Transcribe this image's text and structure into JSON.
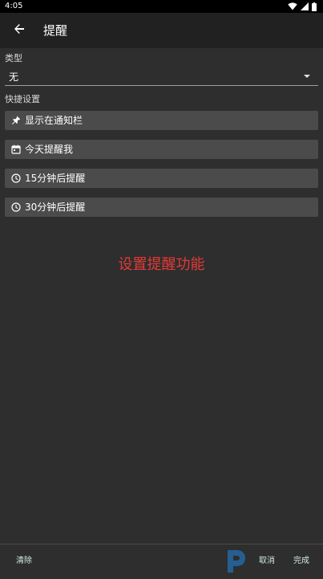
{
  "status_bar": {
    "time": "4:05",
    "icons": [
      "wifi-icon",
      "signal-icon",
      "battery-icon"
    ]
  },
  "app_bar": {
    "back_icon": "arrow-back-icon",
    "title": "提醒"
  },
  "type_section": {
    "label": "类型",
    "selected": "无"
  },
  "quick_section": {
    "label": "快捷设置",
    "buttons": [
      {
        "icon": "pin-icon",
        "label": "显示在通知栏"
      },
      {
        "icon": "calendar-icon",
        "label": "今天提醒我"
      },
      {
        "icon": "clock-icon",
        "label": "15分钟后提醒"
      },
      {
        "icon": "clock-icon",
        "label": "30分钟后提醒"
      }
    ]
  },
  "annotation": {
    "text": "设置提醒功能",
    "color": "#e53935"
  },
  "bottom_bar": {
    "clear_label": "清除",
    "cancel_label": "取消",
    "done_label": "完成"
  },
  "colors": {
    "background": "#2e2e2e",
    "app_bar": "#212121",
    "button_bg": "#4b4b4b",
    "accent_text": "#cfe8e2"
  }
}
